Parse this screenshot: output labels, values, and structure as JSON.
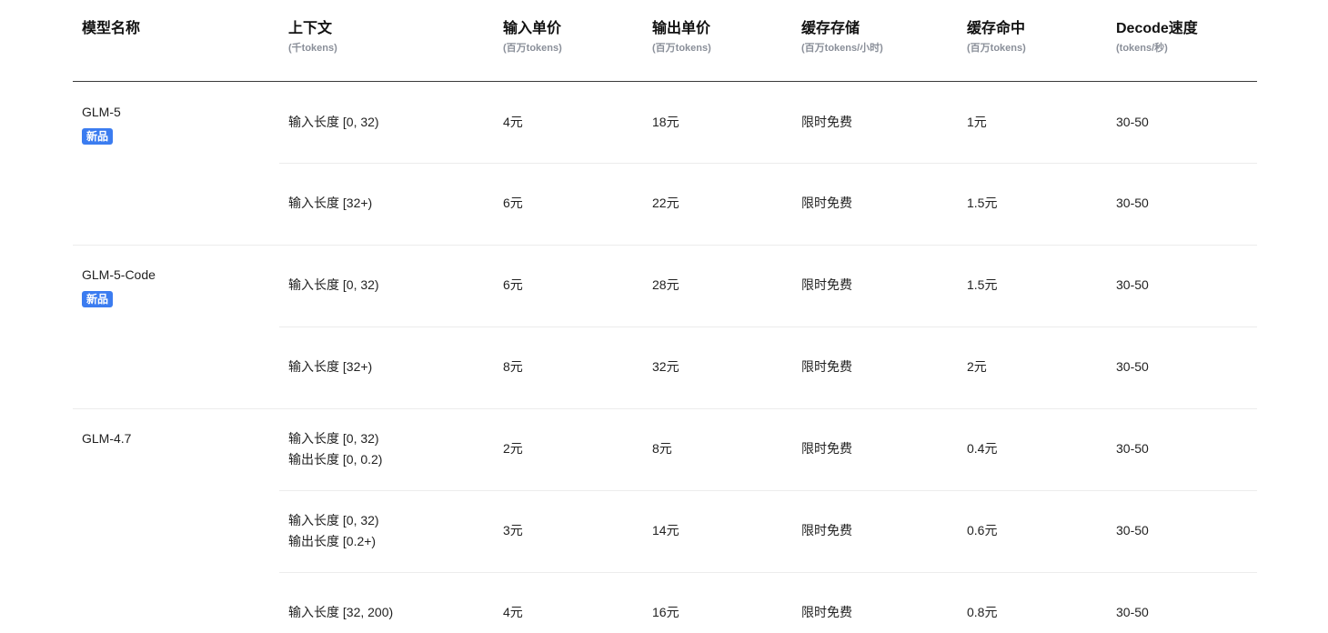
{
  "headers": [
    {
      "title": "模型名称",
      "sub": ""
    },
    {
      "title": "上下文",
      "sub": "(千tokens)"
    },
    {
      "title": "输入单价",
      "sub": "(百万tokens)"
    },
    {
      "title": "输出单价",
      "sub": "(百万tokens)"
    },
    {
      "title": "缓存存储",
      "sub": "(百万tokens/小时)"
    },
    {
      "title": "缓存命中",
      "sub": "(百万tokens)"
    },
    {
      "title": "Decode速度",
      "sub": "(tokens/秒)"
    }
  ],
  "models": [
    {
      "name": "GLM-5",
      "badge": "新品"
    },
    {
      "name": "GLM-5-Code",
      "badge": "新品"
    },
    {
      "name": "GLM-4.7",
      "badge": ""
    }
  ],
  "rows": [
    {
      "context": [
        "输入长度 [0, 32)"
      ],
      "input": "4元",
      "output": "18元",
      "storage": "限时免费",
      "hit": "1元",
      "speed": "30-50"
    },
    {
      "context": [
        "输入长度 [32+)"
      ],
      "input": "6元",
      "output": "22元",
      "storage": "限时免费",
      "hit": "1.5元",
      "speed": "30-50"
    },
    {
      "context": [
        "输入长度 [0, 32)"
      ],
      "input": "6元",
      "output": "28元",
      "storage": "限时免费",
      "hit": "1.5元",
      "speed": "30-50"
    },
    {
      "context": [
        "输入长度 [32+)"
      ],
      "input": "8元",
      "output": "32元",
      "storage": "限时免费",
      "hit": "2元",
      "speed": "30-50"
    },
    {
      "context": [
        "输入长度 [0, 32)",
        "输出长度 [0, 0.2)"
      ],
      "input": "2元",
      "output": "8元",
      "storage": "限时免费",
      "hit": "0.4元",
      "speed": "30-50"
    },
    {
      "context": [
        "输入长度 [0, 32)",
        "输出长度 [0.2+)"
      ],
      "input": "3元",
      "output": "14元",
      "storage": "限时免费",
      "hit": "0.6元",
      "speed": "30-50"
    },
    {
      "context": [
        "输入长度 [32, 200)"
      ],
      "input": "4元",
      "output": "16元",
      "storage": "限时免费",
      "hit": "0.8元",
      "speed": "30-50"
    }
  ]
}
